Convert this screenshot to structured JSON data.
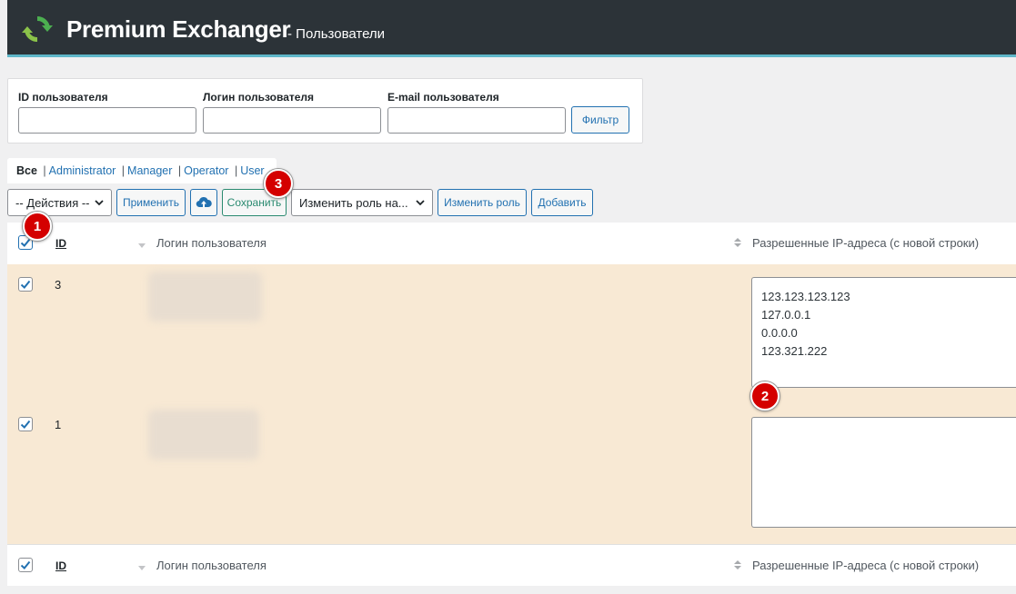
{
  "header": {
    "brand": "Premium Exchanger",
    "subtitle": "- Пользователи",
    "logo_icon": "refresh-arrows-logo",
    "accent": "#5fb7c9"
  },
  "filter": {
    "id_label": "ID пользователя",
    "login_label": "Логин пользователя",
    "email_label": "E-mail пользователя",
    "id_value": "",
    "login_value": "",
    "email_value": "",
    "filter_button": "Фильтр"
  },
  "roles": {
    "all": "Все",
    "items": [
      "Administrator",
      "Manager",
      "Operator",
      "User"
    ],
    "separator": "|"
  },
  "toolbar": {
    "actions_select": "-- Действия --",
    "apply_button": "Применить",
    "upload_icon": "cloud-upload-icon",
    "save_button": "Сохранить",
    "change_role_select": "Изменить роль на...",
    "change_role_button": "Изменить роль",
    "add_button": "Добавить"
  },
  "table": {
    "columns": {
      "id": "ID",
      "login": "Логин пользователя",
      "ips": "Разрешенные IP-адреса (с новой строки)"
    },
    "rows": [
      {
        "id": "3",
        "checked": true,
        "ips": [
          "123.123.123.123",
          "127.0.0.1",
          "0.0.0.0",
          "123.321.222"
        ]
      },
      {
        "id": "1",
        "checked": true,
        "ips": []
      }
    ]
  },
  "annotations": [
    "1",
    "2",
    "3"
  ]
}
